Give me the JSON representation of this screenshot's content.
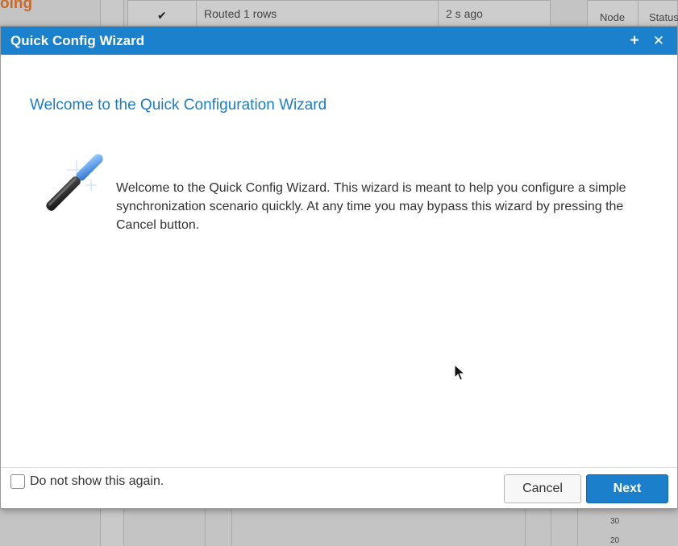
{
  "background": {
    "left_title": "oing",
    "table_row": {
      "check_icon": "checkmark-icon",
      "message": "Routed 1 rows",
      "time": "2 s ago"
    },
    "right_table_headers": [
      "Node",
      "Status"
    ],
    "axis_labels": [
      "30",
      "20"
    ]
  },
  "dialog": {
    "title": "Quick Config Wizard",
    "add_icon": "plus-icon",
    "close_icon": "close-icon",
    "heading": "Welcome to the Quick Configuration Wizard",
    "icon": "magic-wand-icon",
    "body": "Welcome to the Quick Config Wizard. This wizard is meant to help you configure a simple synchronization scenario quickly. At any time you may bypass this wizard by pressing the Cancel button.",
    "checkbox_label": "Do not show this again.",
    "checkbox_checked": false,
    "cancel_label": "Cancel",
    "next_label": "Next",
    "accent_color": "#1b81cc",
    "heading_color": "#1d7cc4"
  }
}
